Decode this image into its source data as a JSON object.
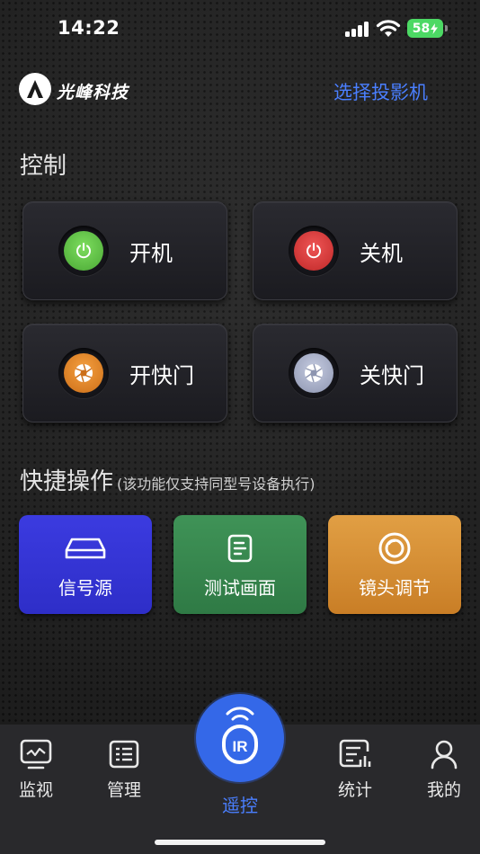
{
  "status_bar": {
    "time": "14:22",
    "battery": "58"
  },
  "header": {
    "brand": "光峰科技",
    "select_projector": "选择投影机"
  },
  "control": {
    "title": "控制",
    "buttons": [
      {
        "label": "开机",
        "icon": "power-icon",
        "color": "#5fbf4a"
      },
      {
        "label": "关机",
        "icon": "power-icon",
        "color": "#d83a3a"
      },
      {
        "label": "开快门",
        "icon": "shutter-icon",
        "color": "#e0852a"
      },
      {
        "label": "关快门",
        "icon": "shutter-icon",
        "color": "#a9b1c9"
      }
    ]
  },
  "quick": {
    "title": "快捷操作",
    "subtitle": "(该功能仅支持同型号设备执行)",
    "buttons": [
      {
        "label": "信号源",
        "icon": "signal-source-icon",
        "color": "#3a3ad8"
      },
      {
        "label": "测试画面",
        "icon": "test-pattern-icon",
        "color": "#3a8a50"
      },
      {
        "label": "镜头调节",
        "icon": "lens-icon",
        "color": "#d8923a"
      }
    ]
  },
  "tabs": [
    {
      "label": "监视",
      "icon": "monitor-icon"
    },
    {
      "label": "管理",
      "icon": "manage-icon"
    },
    {
      "label": "遥控",
      "icon": "ir-remote-icon",
      "active": true
    },
    {
      "label": "统计",
      "icon": "statistics-icon"
    },
    {
      "label": "我的",
      "icon": "profile-icon"
    }
  ],
  "colors": {
    "accent": "#4a7fff",
    "remote_button": "#3468e8"
  }
}
